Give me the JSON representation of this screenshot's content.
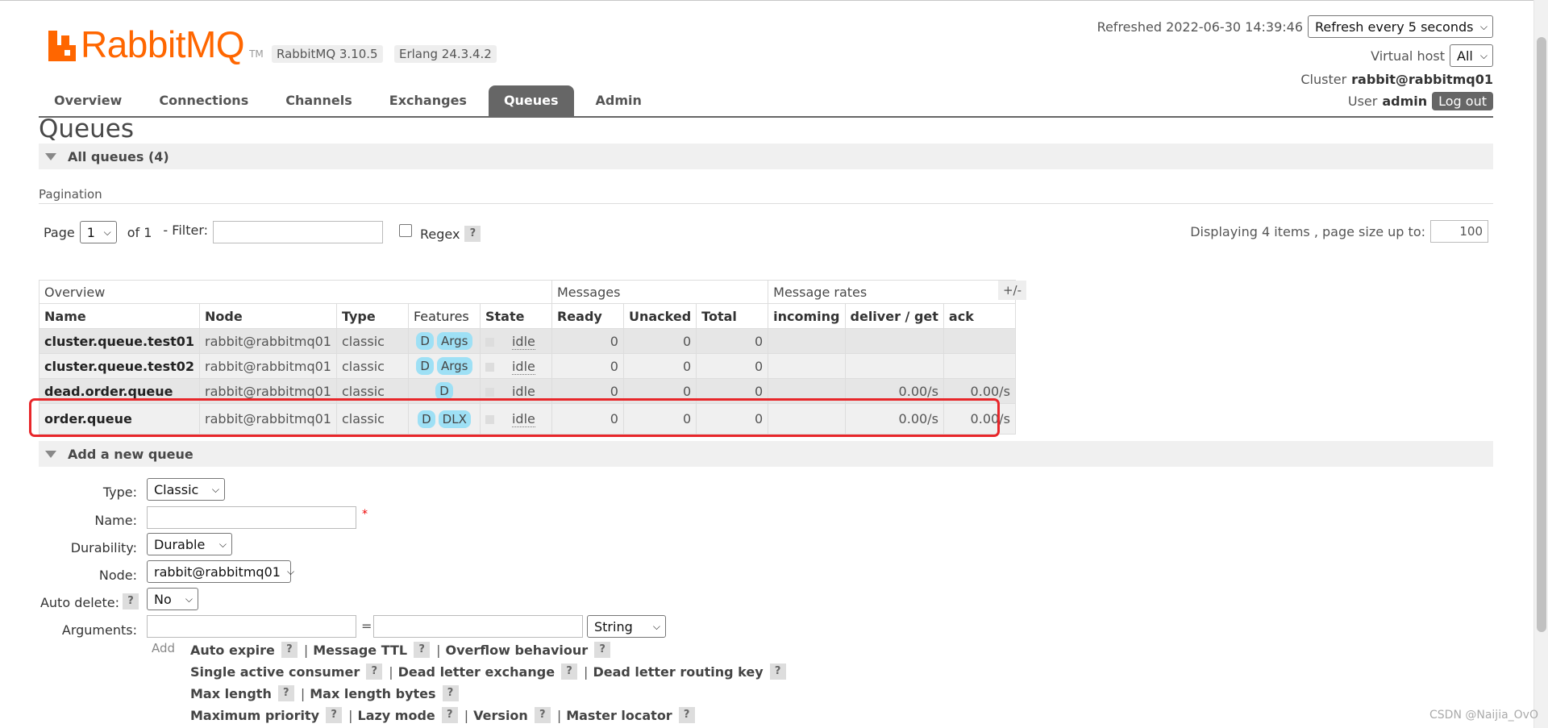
{
  "header": {
    "logo_text": "RabbitMQ",
    "logo_tm": "TM",
    "rabbitmq_version": "RabbitMQ 3.10.5",
    "erlang_version": "Erlang 24.3.4.2",
    "refreshed_text": "Refreshed 2022-06-30 14:39:46",
    "refresh_select": "Refresh every 5 seconds",
    "virtual_host_label": "Virtual host",
    "virtual_host_value": "All",
    "cluster_label": "Cluster",
    "cluster_value": "rabbit@rabbitmq01",
    "user_label": "User",
    "user_value": "admin",
    "logout_label": "Log out"
  },
  "tabs": [
    {
      "label": "Overview"
    },
    {
      "label": "Connections"
    },
    {
      "label": "Channels"
    },
    {
      "label": "Exchanges"
    },
    {
      "label": "Queues"
    },
    {
      "label": "Admin"
    }
  ],
  "page": {
    "title": "Queues",
    "all_queues_label": "All queues (4)",
    "pagination_label": "Pagination",
    "page_label": "Page",
    "page_value": "1",
    "of_label": "of 1",
    "filter_label": "- Filter:",
    "regex_label": "Regex",
    "help": "?",
    "displaying_text": "Displaying 4 items , page size up to:",
    "page_size": "100",
    "plus_minus": "+/-"
  },
  "table": {
    "groups": [
      "Overview",
      "Messages",
      "Message rates"
    ],
    "columns": [
      "Name",
      "Node",
      "Type",
      "Features",
      "State",
      "Ready",
      "Unacked",
      "Total",
      "incoming",
      "deliver / get",
      "ack"
    ],
    "rows": [
      {
        "name": "cluster.queue.test01",
        "node": "rabbit@rabbitmq01",
        "type": "classic",
        "features": [
          "D",
          "Args"
        ],
        "state": "idle",
        "ready": "0",
        "unacked": "0",
        "total": "0",
        "incoming": "",
        "deliver_get": "",
        "ack": ""
      },
      {
        "name": "cluster.queue.test02",
        "node": "rabbit@rabbitmq01",
        "type": "classic",
        "features": [
          "D",
          "Args"
        ],
        "state": "idle",
        "ready": "0",
        "unacked": "0",
        "total": "0",
        "incoming": "",
        "deliver_get": "",
        "ack": ""
      },
      {
        "name": "dead.order.queue",
        "node": "rabbit@rabbitmq01",
        "type": "classic",
        "features": [
          "D"
        ],
        "state": "idle",
        "ready": "0",
        "unacked": "0",
        "total": "0",
        "incoming": "",
        "deliver_get": "0.00/s",
        "ack": "0.00/s"
      },
      {
        "name": "order.queue",
        "node": "rabbit@rabbitmq01",
        "type": "classic",
        "features": [
          "D",
          "DLX"
        ],
        "state": "idle",
        "ready": "0",
        "unacked": "0",
        "total": "0",
        "incoming": "",
        "deliver_get": "0.00/s",
        "ack": "0.00/s"
      }
    ]
  },
  "add_queue": {
    "section_label": "Add a new queue",
    "type_label": "Type:",
    "type_value": "Classic",
    "name_label": "Name:",
    "required_mark": "*",
    "durability_label": "Durability:",
    "durability_value": "Durable",
    "node_label": "Node:",
    "node_value": "rabbit@rabbitmq01",
    "auto_delete_label": "Auto delete:",
    "auto_delete_value": "No",
    "arguments_label": "Arguments:",
    "equals": "=",
    "arg_type_value": "String",
    "add_label": "Add",
    "argument_links": [
      [
        "Auto expire",
        "Message TTL",
        "Overflow behaviour"
      ],
      [
        "Single active consumer",
        "Dead letter exchange",
        "Dead letter routing key"
      ],
      [
        "Max length",
        "Max length bytes"
      ],
      [
        "Maximum priority",
        "Lazy mode",
        "Version",
        "Master locator"
      ]
    ]
  },
  "watermark": "CSDN @Naijia_OvO"
}
